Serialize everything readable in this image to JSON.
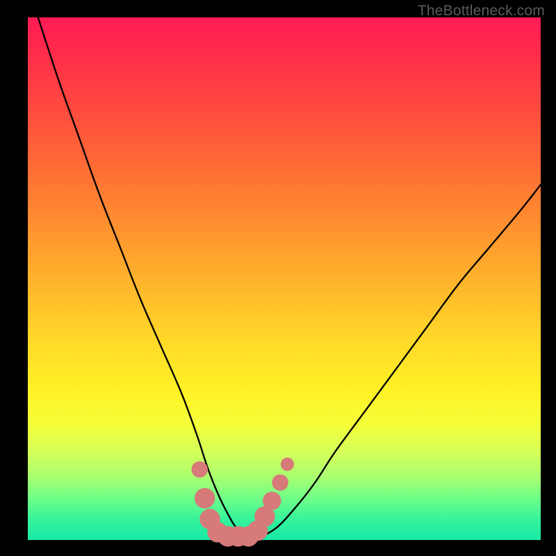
{
  "watermark": "TheBottleneck.com",
  "chart_data": {
    "type": "line",
    "title": "",
    "xlabel": "",
    "ylabel": "",
    "xlim": [
      0,
      100
    ],
    "ylim": [
      0,
      100
    ],
    "grid": false,
    "legend": false,
    "annotations": [],
    "series": [
      {
        "name": "bottleneck-curve",
        "color": "#000000",
        "x": [
          2,
          6,
          10,
          14,
          18,
          22,
          26,
          30,
          33,
          35,
          37,
          39,
          41,
          44,
          48,
          52,
          56,
          60,
          66,
          72,
          78,
          84,
          90,
          96,
          100
        ],
        "y": [
          100,
          88,
          77,
          66,
          56,
          46,
          37,
          28,
          20,
          14,
          9,
          5,
          2,
          0.5,
          2,
          6,
          11,
          17,
          25,
          33,
          41,
          49,
          56,
          63,
          68
        ]
      }
    ],
    "markers": [
      {
        "x": 33.5,
        "y": 13.5,
        "r": 1.6,
        "color": "#d67a7a"
      },
      {
        "x": 34.5,
        "y": 8.0,
        "r": 2.0,
        "color": "#d67a7a"
      },
      {
        "x": 35.5,
        "y": 4.0,
        "r": 2.0,
        "color": "#d67a7a"
      },
      {
        "x": 37.0,
        "y": 1.5,
        "r": 2.0,
        "color": "#d67a7a"
      },
      {
        "x": 39.0,
        "y": 0.7,
        "r": 2.0,
        "color": "#d67a7a"
      },
      {
        "x": 41.0,
        "y": 0.7,
        "r": 2.0,
        "color": "#d67a7a"
      },
      {
        "x": 43.0,
        "y": 0.7,
        "r": 2.0,
        "color": "#d67a7a"
      },
      {
        "x": 44.8,
        "y": 1.8,
        "r": 2.0,
        "color": "#d67a7a"
      },
      {
        "x": 46.2,
        "y": 4.5,
        "r": 2.0,
        "color": "#d67a7a"
      },
      {
        "x": 47.6,
        "y": 7.5,
        "r": 1.8,
        "color": "#d67a7a"
      },
      {
        "x": 49.2,
        "y": 11.0,
        "r": 1.6,
        "color": "#d67a7a"
      },
      {
        "x": 50.6,
        "y": 14.5,
        "r": 1.3,
        "color": "#d67a7a"
      }
    ]
  }
}
